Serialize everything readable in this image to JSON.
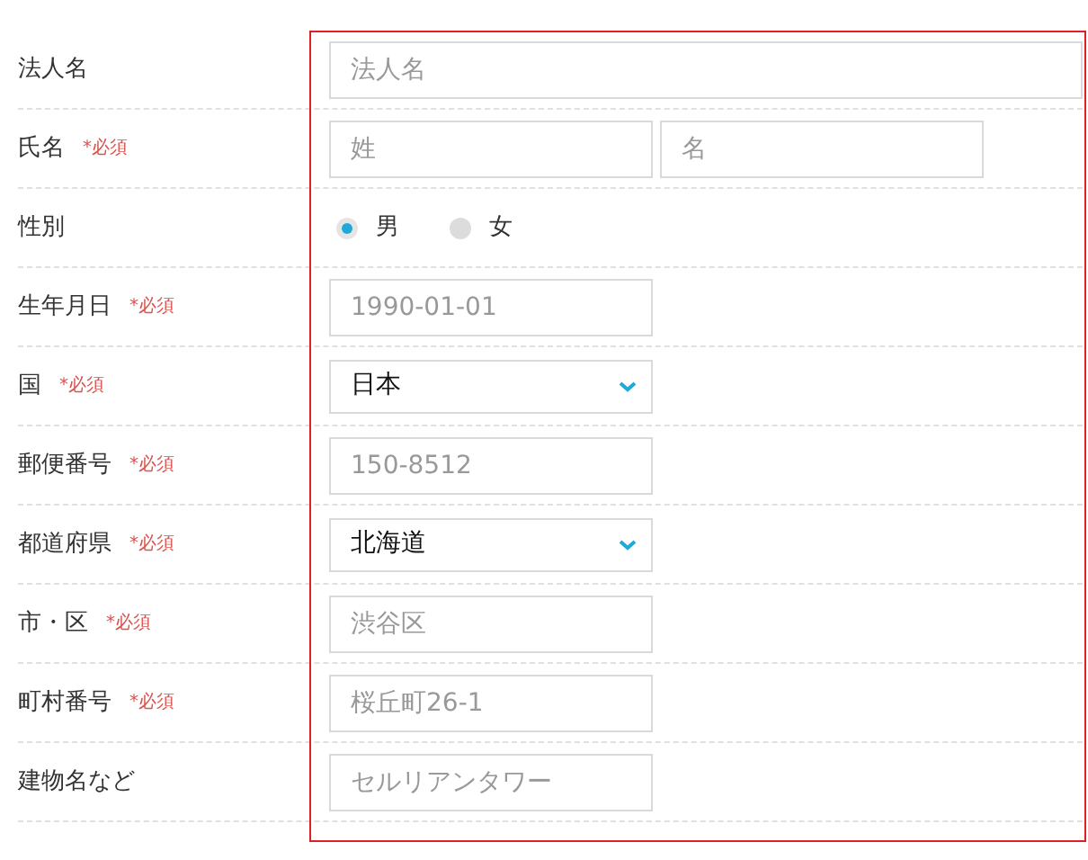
{
  "fields": [
    {
      "label": "法人名",
      "kind": "text",
      "wide": true,
      "placeholder": "法人名"
    },
    {
      "label": "氏名",
      "required_mark": "*必須",
      "kind": "name",
      "placeholders": [
        "姓",
        "名"
      ]
    },
    {
      "label": "性別",
      "kind": "radio",
      "options": [
        {
          "label": "男",
          "selected": true
        },
        {
          "label": "女",
          "selected": false
        }
      ]
    },
    {
      "label": "生年月日",
      "required_mark": "*必須",
      "kind": "text",
      "wide": false,
      "placeholder": "1990-01-01"
    },
    {
      "label": "国",
      "required_mark": "*必須",
      "kind": "select",
      "value": "日本"
    },
    {
      "label": "郵便番号",
      "required_mark": "*必須",
      "kind": "text",
      "wide": false,
      "placeholder": "150-8512"
    },
    {
      "label": "都道府県",
      "required_mark": "*必須",
      "kind": "select",
      "value": "北海道"
    },
    {
      "label": "市・区",
      "required_mark": "*必須",
      "kind": "text",
      "wide": false,
      "placeholder": "渋谷区"
    },
    {
      "label": "町村番号",
      "required_mark": "*必須",
      "kind": "text",
      "wide": false,
      "placeholder": "桜丘町26-1"
    },
    {
      "label": "建物名など",
      "kind": "text",
      "wide": false,
      "placeholder": "セルリアンタワー"
    }
  ]
}
